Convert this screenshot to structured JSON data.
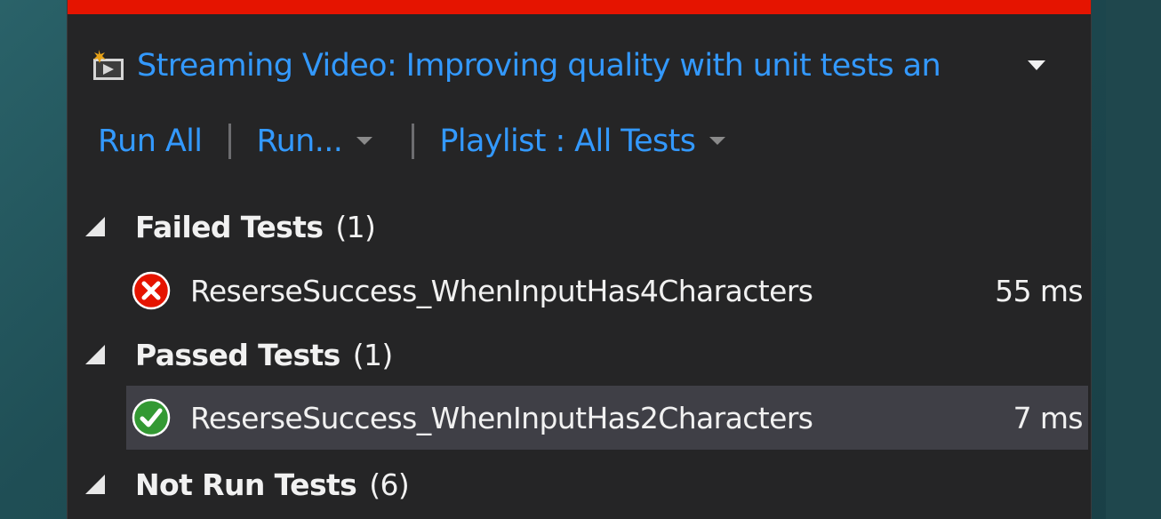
{
  "header": {
    "title": "Streaming Video: Improving quality with unit tests an",
    "icon": "project-icon"
  },
  "run_progress": {
    "fraction": 1.0,
    "color": "#e51400"
  },
  "toolbar": {
    "run_all_label": "Run All",
    "run_label": "Run...",
    "playlist_label": "Playlist : All Tests"
  },
  "groups": [
    {
      "name": "Failed Tests",
      "count": "(1)",
      "tests": [
        {
          "name": "ReserseSuccess_WhenInputHas4Characters",
          "duration": "55 ms",
          "status": "failed",
          "icon": "failed-x-icon",
          "status_color": "#e51400"
        }
      ]
    },
    {
      "name": "Passed Tests",
      "count": "(1)",
      "tests": [
        {
          "name": "ReserseSuccess_WhenInputHas2Characters",
          "duration": "7 ms",
          "status": "passed",
          "icon": "passed-check-icon",
          "status_color": "#339933",
          "selected": true
        }
      ]
    },
    {
      "name": "Not Run Tests",
      "count": "(6)",
      "tests": []
    }
  ],
  "colors": {
    "accent_link": "#3399ff",
    "panel_background": "#252526",
    "selected_row": "#3f3f46",
    "text": "#f1f1f1"
  }
}
